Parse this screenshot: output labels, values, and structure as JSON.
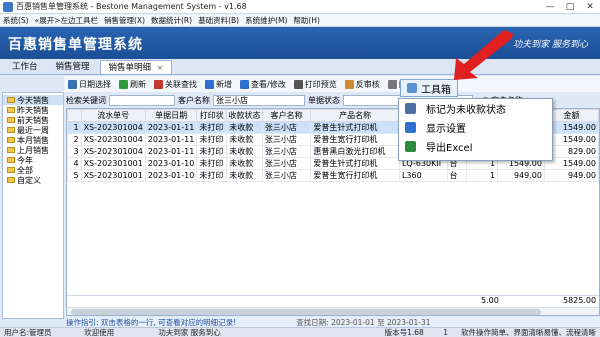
{
  "window": {
    "title": "百惠销售单管理系统 - Bestone Management System - v1.68",
    "controls": [
      "—",
      "□",
      "✕"
    ]
  },
  "menu": [
    "系统(S)",
    "«展开>左边工具栏",
    "销售管理(X)",
    "数据统计(R)",
    "基础资料(B)",
    "系统维护(M)",
    "帮助(H)"
  ],
  "banner": {
    "brand": "百惠销售单管理系统",
    "slogan": "功夫到家  服务到心"
  },
  "tabs": [
    {
      "label": "工作台"
    },
    {
      "label": "销售管理"
    },
    {
      "label": "销售单明细",
      "close": "×"
    }
  ],
  "toolbar": [
    {
      "label": "日期选择",
      "icon": "calendar-icon",
      "color": "#3b6fb6"
    },
    {
      "label": "刷新",
      "icon": "refresh-icon",
      "color": "#2e9b3c"
    },
    {
      "label": "关联查找",
      "icon": "link-icon",
      "color": "#c0392b"
    },
    {
      "label": "新增",
      "icon": "plus-icon",
      "color": "#2f6fd0"
    },
    {
      "label": "查看/修改",
      "icon": "edit-icon",
      "color": "#2f6fd0"
    },
    {
      "label": "打印预览",
      "icon": "printer-icon",
      "color": "#555555"
    },
    {
      "label": "反审核",
      "icon": "undo-icon",
      "color": "#d08a2f"
    },
    {
      "label": "删除",
      "icon": "delete-icon",
      "color": "#777777"
    }
  ],
  "tree": [
    {
      "label": "今天销售",
      "selected": true
    },
    {
      "label": "昨天销售"
    },
    {
      "label": "前天销售"
    },
    {
      "label": "最近一周"
    },
    {
      "label": "本月销售"
    },
    {
      "label": "上月销售"
    },
    {
      "label": "今年"
    },
    {
      "label": "全部"
    },
    {
      "label": "自定义"
    }
  ],
  "filter": {
    "keyword_label": "检索关键词",
    "customer_label": "客户名称",
    "customer_value": "张三小店",
    "status_label": "单据状态",
    "radio_label": "客户名称"
  },
  "grid": {
    "columns": [
      "",
      "流水单号",
      "单据日期",
      "打印状",
      "收款状态",
      "客户名称",
      "产品名称",
      "",
      "",
      "",
      "",
      "金额"
    ],
    "rows": [
      [
        "1",
        "XS-202301004",
        "2023-01-11",
        "未打印",
        "未收款",
        "张三小店",
        "爱普生针式打印机",
        "",
        "",
        "",
        "",
        "1549.00"
      ],
      [
        "2",
        "XS-202301004",
        "2023-01-11",
        "未打印",
        "未收款",
        "张三小店",
        "爱普生宽行打印机",
        "",
        "",
        "",
        "",
        "1549.00"
      ],
      [
        "3",
        "XS-202301004",
        "2023-01-11",
        "未打印",
        "未收款",
        "张三小店",
        "惠普黑白激光打印机",
        "",
        "",
        "",
        "",
        "829.00"
      ],
      [
        "4",
        "XS-202301001",
        "2023-01-10",
        "未打印",
        "未收款",
        "张三小店",
        "爱普生针式打印机",
        "LQ-630KII",
        "台",
        "1",
        "1549.00",
        "1549.00"
      ],
      [
        "5",
        "XS-202301001",
        "2023-01-10",
        "未打印",
        "未收款",
        "张三小店",
        "爱普生宽行打印机",
        "L360",
        "台",
        "1",
        "949.00",
        "949.00"
      ]
    ],
    "selected_row": 0,
    "footer": {
      "qty": "5.00",
      "amount": "5825.00"
    }
  },
  "hint": {
    "text": "操作指引: 双击表格的一行, 可查看对应的明细记录!",
    "date": "查找日期: 2023-01-01 至 2023-01-31"
  },
  "status": [
    "用户名:管理员",
    "欢迎使用",
    "功夫到家 服务到心",
    "版本号1.68",
    "1",
    "软件操作简单、界面清晰易懂、流程清晰"
  ],
  "dropdown": {
    "header": "工具箱",
    "items": [
      {
        "label": "标记为未收款状态",
        "icon": "table-icon",
        "color": "#4a6fa5"
      },
      {
        "label": "显示设置",
        "icon": "grid-icon",
        "color": "#2f6fd0"
      },
      {
        "label": "导出Excel",
        "icon": "excel-icon",
        "color": "#2e8b3e"
      }
    ]
  },
  "colors": {
    "accent": "#1b4f97",
    "arrow": "#e02020"
  }
}
